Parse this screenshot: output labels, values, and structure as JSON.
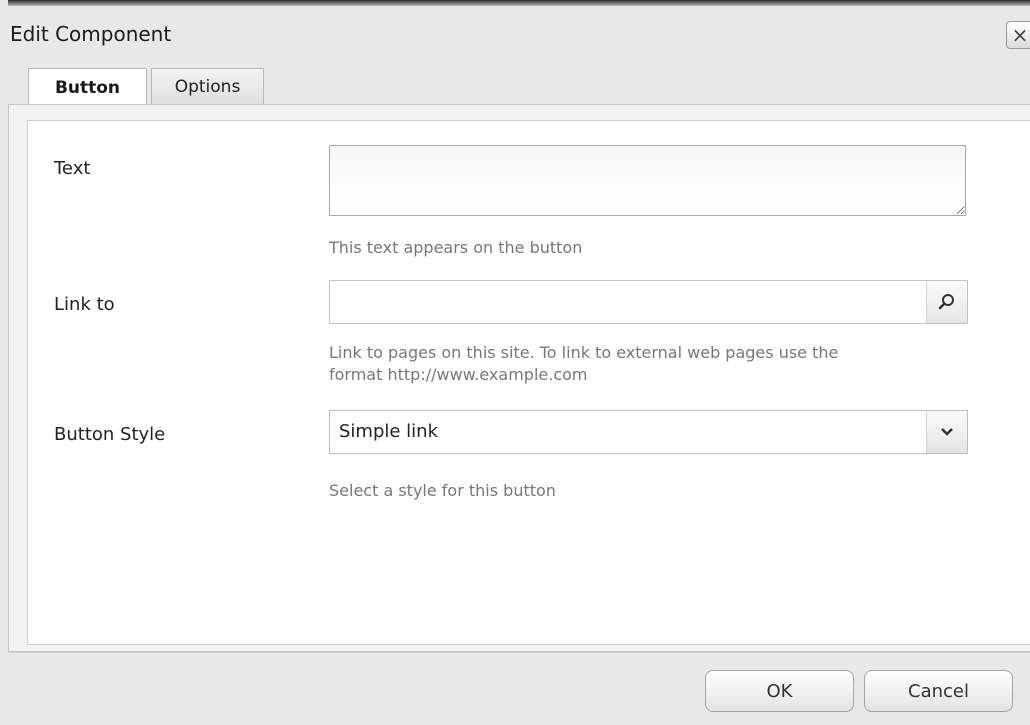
{
  "dialog": {
    "title": "Edit Component",
    "close_icon": "close-icon"
  },
  "tabs": [
    {
      "label": "Button",
      "active": true
    },
    {
      "label": "Options",
      "active": false
    }
  ],
  "form": {
    "text_label": "Text",
    "text_value": "",
    "text_hint": "This text appears on the button",
    "link_label": "Link to",
    "link_value": "",
    "link_hint_line1": "Link to pages on this site. To link to external web pages use the",
    "link_hint_line2": "format http://www.example.com",
    "link_search_icon": "search-icon",
    "style_label": "Button Style",
    "style_selected": "Simple link",
    "style_dropdown_icon": "chevron-down-icon",
    "style_hint": "Select a style for this button"
  },
  "actions": {
    "ok_label": "OK",
    "cancel_label": "Cancel"
  }
}
